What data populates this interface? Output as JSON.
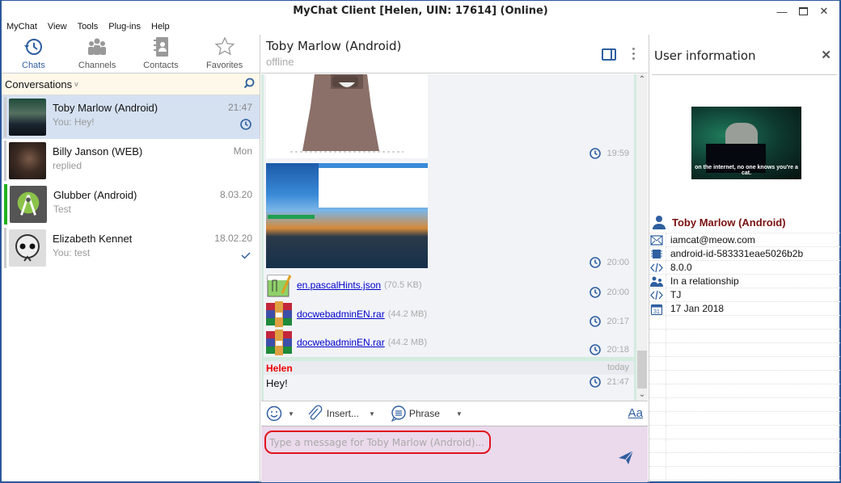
{
  "window": {
    "title": "MyChat Client [Helen, UIN: 17614] (Online)",
    "controls": [
      "minimize",
      "maximize",
      "close"
    ]
  },
  "menu": [
    "MyChat",
    "View",
    "Tools",
    "Plug-ins",
    "Help"
  ],
  "nav_tabs": [
    {
      "label": "Chats",
      "icon": "history-icon",
      "active": true
    },
    {
      "label": "Channels",
      "icon": "group-icon",
      "active": false
    },
    {
      "label": "Contacts",
      "icon": "address-book-icon",
      "active": false
    },
    {
      "label": "Favorites",
      "icon": "star-icon",
      "active": false
    }
  ],
  "conversations_header": {
    "label": "Conversations",
    "dropdown_glyph": "v"
  },
  "conversations": [
    {
      "name": "Toby Marlow (Android)",
      "last": "You: Hey!",
      "time": "21:47",
      "status": "pending",
      "active": true
    },
    {
      "name": "Billy Janson (WEB)",
      "last": "replied",
      "time": "Mon",
      "status": "",
      "active": false
    },
    {
      "name": "Glubber (Android)",
      "last": "Test",
      "time": "8.03.20",
      "status": "",
      "active": false,
      "online": true
    },
    {
      "name": "Elizabeth Kennet",
      "last": "You: test",
      "time": "18.02.20",
      "status": "read",
      "active": false
    }
  ],
  "chat": {
    "contact_name": "Toby Marlow (Android)",
    "contact_status": "offline",
    "messages": [
      {
        "type": "image",
        "desc": "sticker",
        "time": "19:59",
        "status": "pending"
      },
      {
        "type": "image",
        "desc": "screenshot",
        "time": "20:00",
        "status": "pending"
      },
      {
        "type": "file",
        "name": "en.pascalHints.json",
        "size": "(70.5 KB)",
        "time": "20:00",
        "status": "pending"
      },
      {
        "type": "file",
        "name": "docwebadminEN.rar",
        "size": "(44.2 MB)",
        "time": "20:17",
        "status": "pending"
      },
      {
        "type": "file",
        "name": "docwebadminEN.rar",
        "size": "(44.2 MB)",
        "time": "20:18",
        "status": "pending"
      }
    ],
    "last_message": {
      "sender": "Helen",
      "day": "today",
      "text": "Hey!",
      "time": "21:47"
    },
    "toolbar": {
      "insert_label": "Insert...",
      "phrase_label": "Phrase",
      "font_glyph": "Aa"
    },
    "compose_placeholder": "Type a message for Toby Marlow (Android)..."
  },
  "user_info": {
    "title": "User information",
    "photo_caption": "on the internet, no one knows you're a cat.",
    "name": "Toby Marlow (Android)",
    "fields": [
      {
        "icon": "email-icon",
        "value": "iamcat@meow.com"
      },
      {
        "icon": "chip-icon",
        "value": "android-id-583331eae5026b2b"
      },
      {
        "icon": "code-icon",
        "value": "8.0.0"
      },
      {
        "icon": "relationship-icon",
        "value": "In a relationship"
      },
      {
        "icon": "code-icon",
        "value": "TJ"
      },
      {
        "icon": "calendar-icon",
        "value": "17 Jan 2018"
      }
    ],
    "empty_rows": 12
  },
  "colors": {
    "accent": "#2f5fa0",
    "selected_row": "#d5e1f1",
    "sender_name": "#e00000",
    "user_name": "#7a1010",
    "compose_bg": "#ebdaec",
    "highlight_border": "#e0141e",
    "online_bar": "#1fb31f"
  }
}
